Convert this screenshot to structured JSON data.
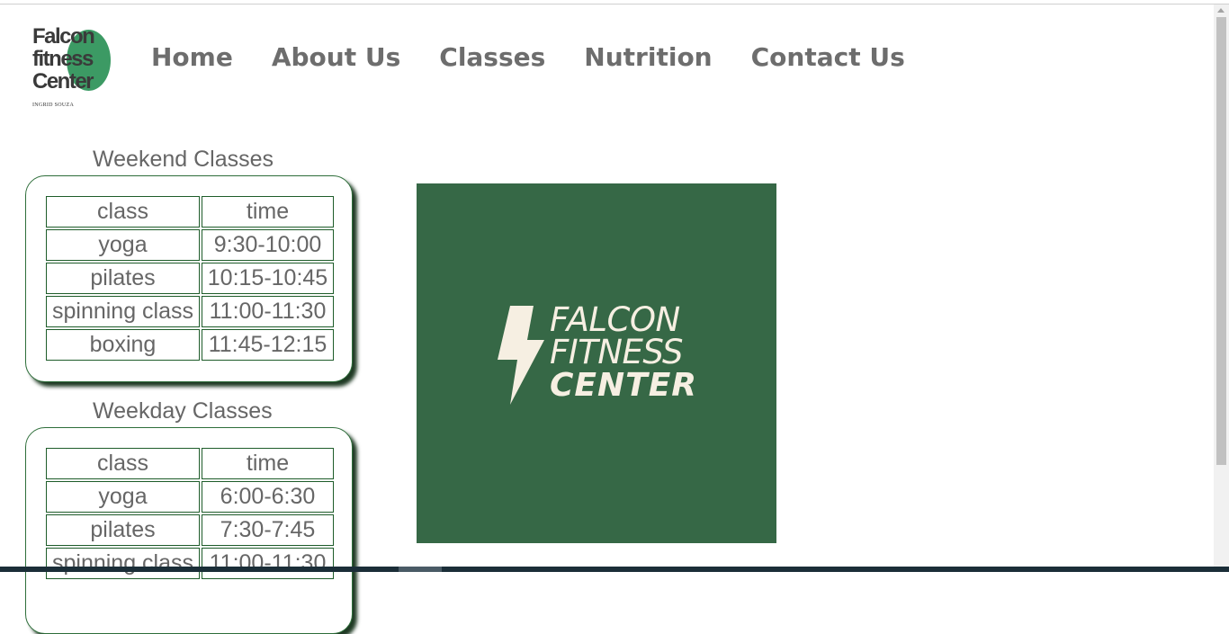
{
  "logo": {
    "line1": "Falcon",
    "line2": "fitness",
    "line3": "Center",
    "subtitle": "INGRID SOUZA"
  },
  "nav": {
    "items": [
      "Home",
      "About Us",
      "Classes",
      "Nutrition",
      "Contact Us"
    ]
  },
  "weekend": {
    "title": "Weekend Classes",
    "header": [
      "class",
      "time"
    ],
    "rows": [
      [
        "yoga",
        "9:30-10:00"
      ],
      [
        "pilates",
        "10:15-10:45"
      ],
      [
        "spinning class",
        "11:00-11:30"
      ],
      [
        "boxing",
        "11:45-12:15"
      ]
    ]
  },
  "weekday": {
    "title": "Weekday Classes",
    "header": [
      "class",
      "time"
    ],
    "rows": [
      [
        "yoga",
        "6:00-6:30"
      ],
      [
        "pilates",
        "7:30-7:45"
      ],
      [
        "spinning class",
        "11:00-11:30"
      ]
    ]
  },
  "poster": {
    "line1": "FALCON",
    "line2": "FITNESS",
    "line3": "CENTER"
  },
  "colors": {
    "brand_green": "#366846",
    "logo_green": "#3c9a64",
    "nav_gray": "#6d6d6d",
    "text_gray": "#666666",
    "table_border": "#1e5c2a"
  }
}
